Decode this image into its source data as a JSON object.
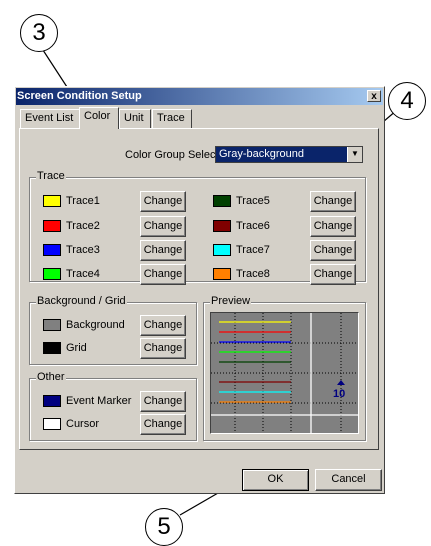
{
  "callouts": [
    "3",
    "4",
    "5"
  ],
  "dialog": {
    "title": "Screen Condition Setup",
    "close_glyph": "x",
    "tabs": [
      "Event List",
      "Color",
      "Unit",
      "Trace"
    ],
    "color_group_label": "Color Group Select",
    "color_group_value": "Gray-background",
    "trace_group_label": "Trace",
    "traces": [
      {
        "label": "Trace1",
        "color": "#ffff00"
      },
      {
        "label": "Trace2",
        "color": "#ff0000"
      },
      {
        "label": "Trace3",
        "color": "#0000ff"
      },
      {
        "label": "Trace4",
        "color": "#00ff00"
      },
      {
        "label": "Trace5",
        "color": "#004000"
      },
      {
        "label": "Trace6",
        "color": "#800000"
      },
      {
        "label": "Trace7",
        "color": "#00ffff"
      },
      {
        "label": "Trace8",
        "color": "#ff8000"
      }
    ],
    "change_label": "Change",
    "bg_group_label": "Background / Grid",
    "background_label": "Background",
    "background_color": "#808080",
    "grid_label": "Grid",
    "grid_color": "#000000",
    "other_group_label": "Other",
    "event_marker_label": "Event Marker",
    "event_marker_color": "#000080",
    "cursor_label": "Cursor",
    "cursor_color": "#ffffff",
    "preview_label": "Preview",
    "preview_marker_text": "10",
    "ok_label": "OK",
    "cancel_label": "Cancel"
  }
}
